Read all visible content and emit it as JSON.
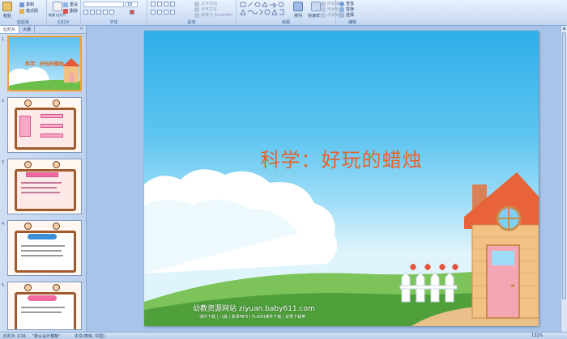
{
  "ribbon": {
    "clipboard": {
      "paste": "粘贴",
      "copy": "复制",
      "format_painter": "格式刷",
      "group": "剪贴板"
    },
    "slides": {
      "new_slide": "新建\n幻灯片",
      "reset": "重设",
      "delete": "删除",
      "group": "幻灯片"
    },
    "font": {
      "size": "18",
      "group": "字体"
    },
    "paragraph": {
      "text_direction": "文字方向",
      "align_text": "对齐文本",
      "convert_smartart": "转换为 SmartArt",
      "group": "段落"
    },
    "drawing": {
      "arrange": "排列",
      "quick_styles": "快速样式",
      "shape_fill": "形状填充",
      "shape_outline": "形状轮廓",
      "shape_effects": "形状效果",
      "group": "绘图"
    },
    "editing": {
      "find": "查找",
      "replace": "替换",
      "select": "选择",
      "group": "编辑"
    }
  },
  "pane": {
    "tabs": [
      "幻灯片",
      "大纲"
    ],
    "close": "×",
    "thumb1_title": "科学：好玩的蜡烛",
    "thumb_numbers": [
      "1",
      "2",
      "3",
      "4",
      "5"
    ]
  },
  "slide": {
    "title": "科学：好玩的蜡烛",
    "website": "幼教资源网站  ziyuan.baby611.com",
    "links": "课件下载  |  儿歌  |  故事MP3  |  FLASH课件下载  |  试卷下载等"
  },
  "status": {
    "slide_info": "幻灯片 1/16",
    "theme": "\"默认设计模板\"",
    "language": "中文(简体, 中国)",
    "zoom": "132%"
  },
  "colors": {
    "title": "#e8612a",
    "sky_top": "#2eaee8",
    "ribbon_bg": "#d6e4f7",
    "workspace": "#a9c4ea"
  }
}
